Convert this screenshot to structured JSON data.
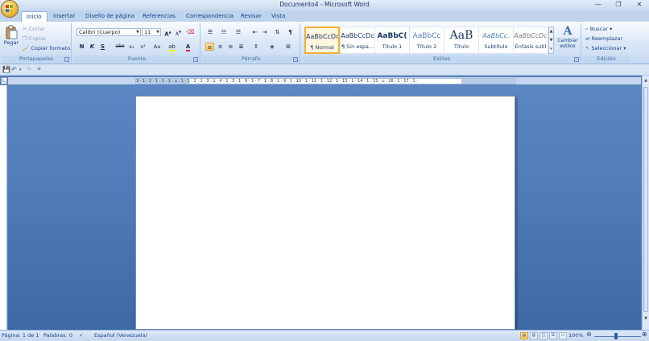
{
  "window": {
    "title": "Documento4 - Microsoft Word",
    "minimize": "—",
    "restore": "❐",
    "close": "✕"
  },
  "tabs": [
    {
      "label": "Inicio",
      "active": true
    },
    {
      "label": "Insertar"
    },
    {
      "label": "Diseño de página"
    },
    {
      "label": "Referencias"
    },
    {
      "label": "Correspondencia"
    },
    {
      "label": "Revisar"
    },
    {
      "label": "Vista"
    }
  ],
  "ribbon": {
    "clipboard": {
      "paste": "Pegar",
      "cut": "Cortar",
      "copy": "Copiar",
      "format_painter": "Copiar formato",
      "label": "Portapapeles"
    },
    "font": {
      "name": "Calibri (Cuerpo)",
      "size": "11",
      "label": "Fuente",
      "bold": "N",
      "italic": "K",
      "underline": "S",
      "strike": "abe",
      "subscript": "x₂",
      "superscript": "x²",
      "change_case": "Aa",
      "grow": "A",
      "shrink": "A"
    },
    "paragraph": {
      "label": "Párrafo"
    },
    "styles": {
      "label": "Estilos",
      "items": [
        {
          "sample": "AaBbCcDc",
          "name": "¶ Normal",
          "selected": true
        },
        {
          "sample": "AaBbCcDc",
          "name": "¶ Sin espa..."
        },
        {
          "sample": "AaBbC(",
          "name": "Título 1"
        },
        {
          "sample": "AaBbCc",
          "name": "Título 2"
        },
        {
          "sample": "AaB",
          "name": "Título"
        },
        {
          "sample": "AaBbCc.",
          "name": "Subtítulo"
        },
        {
          "sample": "AaBbCcDc",
          "name": "Énfasis sutil"
        }
      ],
      "change_styles": "Cambiar estilos"
    },
    "editing": {
      "find": "Buscar",
      "replace": "Reemplazar",
      "select": "Seleccionar",
      "label": "Edición"
    }
  },
  "ruler": {
    "marks": "3 · 1 · 2 · 1 · 1 · 1 · ⌂ · 1 · 1 · 2 · 1 · 3 · 1 · 4 · 1 · 5 · 1 · 6 · 1 · 7 · 1 · 8 · 1 · 9 · 1 · 10 · 1 · 11 · 1 · 12 · 1 · 13 · 1 · 14 · 1 · 15 · ⌂ · 16 · 1 · 17 · 1 ·"
  },
  "status": {
    "page": "Página: 1 de 1",
    "words": "Palabras: 0",
    "language": "Español (Venezuela)",
    "zoom": "100%"
  },
  "colors": {
    "accent": "#15428b",
    "doc_bg": "#4e78b4"
  }
}
